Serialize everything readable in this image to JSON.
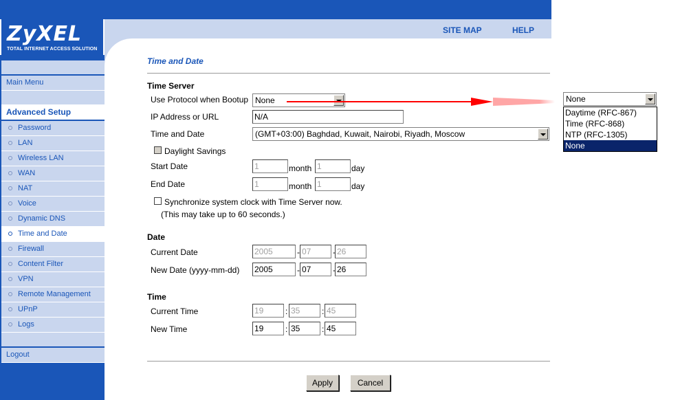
{
  "brand": {
    "name": "ZyXEL",
    "tagline": "TOTAL INTERNET ACCESS SOLUTION"
  },
  "header": {
    "site_map": "SITE MAP",
    "help": "HELP"
  },
  "sidebar": {
    "main_menu": "Main Menu",
    "section_title": "Advanced Setup",
    "items": [
      {
        "label": "Password"
      },
      {
        "label": "LAN"
      },
      {
        "label": "Wireless LAN"
      },
      {
        "label": "WAN"
      },
      {
        "label": "NAT"
      },
      {
        "label": "Voice"
      },
      {
        "label": "Dynamic DNS"
      },
      {
        "label": "Time and Date",
        "active": true
      },
      {
        "label": "Firewall"
      },
      {
        "label": "Content Filter"
      },
      {
        "label": "VPN"
      },
      {
        "label": "Remote Management"
      },
      {
        "label": "UPnP"
      },
      {
        "label": "Logs"
      }
    ],
    "logout": "Logout"
  },
  "page": {
    "title": "Time and Date",
    "time_server": {
      "heading": "Time Server",
      "protocol_label": "Use Protocol when Bootup",
      "protocol_value": "None",
      "ip_label": "IP Address or URL",
      "ip_value": "N/A",
      "timezone_label": "Time and Date",
      "timezone_value": "(GMT+03:00) Baghdad, Kuwait, Nairobi, Riyadh, Moscow",
      "daylight_label": "Daylight Savings",
      "start_label": "Start Date",
      "end_label": "End Date",
      "start_month": "1",
      "start_day": "1",
      "end_month": "1",
      "end_day": "1",
      "month_text": "month",
      "day_text": "day",
      "sync_label": "Synchronize system clock with Time Server now.",
      "sync_note": "(This may take up to 60 seconds.)"
    },
    "date": {
      "heading": "Date",
      "current_label": "Current Date",
      "new_label": "New Date (yyyy-mm-dd)",
      "current": {
        "year": "2005",
        "month": "07",
        "day": "26"
      },
      "new": {
        "year": "2005",
        "month": "07",
        "day": "26"
      },
      "separator": "-"
    },
    "time": {
      "heading": "Time",
      "current_label": "Current Time",
      "new_label": "New Time",
      "current": {
        "hour": "19",
        "minute": "35",
        "second": "45"
      },
      "new": {
        "hour": "19",
        "minute": "35",
        "second": "45"
      },
      "separator": ":"
    },
    "buttons": {
      "apply": "Apply",
      "cancel": "Cancel"
    }
  },
  "protocol_dropdown": {
    "selected": "None",
    "options": [
      {
        "label": "Daytime (RFC-867)"
      },
      {
        "label": "Time (RFC-868)"
      },
      {
        "label": "NTP (RFC-1305)"
      },
      {
        "label": "None",
        "selected": true
      }
    ]
  },
  "colors": {
    "brand_blue": "#1a56b8",
    "panel_light": "#c9d6ee",
    "arrow_red": "#ff0000",
    "list_highlight": "#0a246a"
  }
}
